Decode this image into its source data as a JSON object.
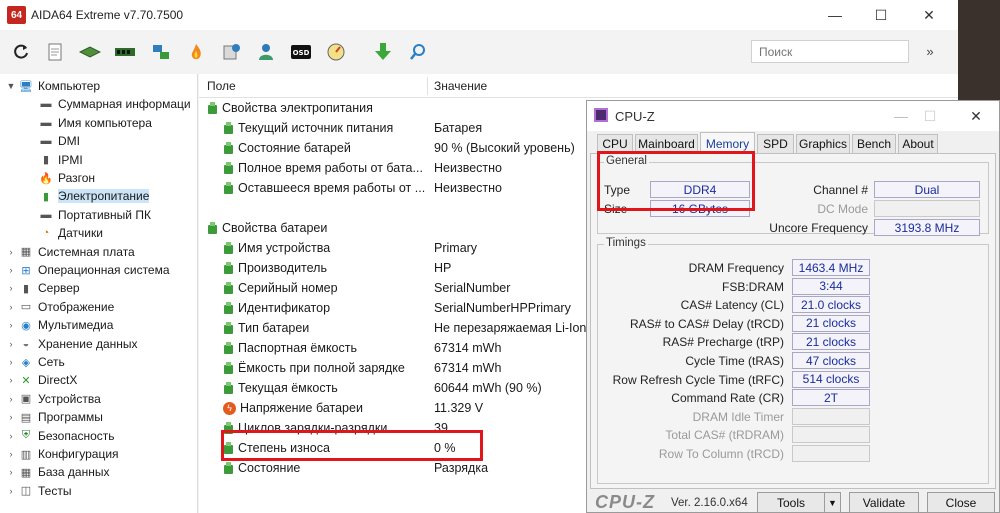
{
  "aida": {
    "title": "AIDA64 Extreme v7.70.7500",
    "logo": "64",
    "search_placeholder": "Поиск",
    "search_more": "»",
    "toolbar_icons": [
      "refresh-icon",
      "report-icon",
      "motherboard-icon",
      "memory-icon",
      "network-icon",
      "flame-icon",
      "benchmark-icon",
      "user-icon",
      "osd-icon",
      "gauge-icon",
      "download-icon",
      "search-icon"
    ],
    "tree": [
      {
        "label": "Компьютер",
        "level": 0,
        "expander": "▼",
        "icon": "computer-icon",
        "glyph": "🖥"
      },
      {
        "label": "Суммарная информаци",
        "level": 1,
        "expander": "",
        "icon": "summary-icon",
        "glyph": "▬"
      },
      {
        "label": "Имя компьютера",
        "level": 1,
        "expander": "",
        "icon": "pc-name-icon",
        "glyph": "▬"
      },
      {
        "label": "DMI",
        "level": 1,
        "expander": "",
        "icon": "dmi-icon",
        "glyph": "▬"
      },
      {
        "label": "IPMI",
        "level": 1,
        "expander": "",
        "icon": "ipmi-icon",
        "glyph": "▮"
      },
      {
        "label": "Разгон",
        "level": 1,
        "expander": "",
        "icon": "overclock-icon",
        "glyph": "🔥"
      },
      {
        "label": "Электропитание",
        "level": 1,
        "expander": "",
        "icon": "power-icon",
        "glyph": "▮",
        "selected": true
      },
      {
        "label": "Портативный ПК",
        "level": 1,
        "expander": "",
        "icon": "laptop-icon",
        "glyph": "▬"
      },
      {
        "label": "Датчики",
        "level": 1,
        "expander": "",
        "icon": "sensor-icon",
        "glyph": "◔"
      },
      {
        "label": "Системная плата",
        "level": 0,
        "expander": "›",
        "icon": "motherboard-icon",
        "glyph": "▦"
      },
      {
        "label": "Операционная система",
        "level": 0,
        "expander": "›",
        "icon": "windows-icon",
        "glyph": "⊞"
      },
      {
        "label": "Сервер",
        "level": 0,
        "expander": "›",
        "icon": "server-icon",
        "glyph": "▮"
      },
      {
        "label": "Отображение",
        "level": 0,
        "expander": "›",
        "icon": "display-icon",
        "glyph": "▭"
      },
      {
        "label": "Мультимедиа",
        "level": 0,
        "expander": "›",
        "icon": "multimedia-icon",
        "glyph": "◉"
      },
      {
        "label": "Хранение данных",
        "level": 0,
        "expander": "›",
        "icon": "storage-icon",
        "glyph": "◒"
      },
      {
        "label": "Сеть",
        "level": 0,
        "expander": "›",
        "icon": "network-icon",
        "glyph": "◈"
      },
      {
        "label": "DirectX",
        "level": 0,
        "expander": "›",
        "icon": "directx-icon",
        "glyph": "✕"
      },
      {
        "label": "Устройства",
        "level": 0,
        "expander": "›",
        "icon": "devices-icon",
        "glyph": "▣"
      },
      {
        "label": "Программы",
        "level": 0,
        "expander": "›",
        "icon": "programs-icon",
        "glyph": "▤"
      },
      {
        "label": "Безопасность",
        "level": 0,
        "expander": "›",
        "icon": "security-icon",
        "glyph": "⛨"
      },
      {
        "label": "Конфигурация",
        "level": 0,
        "expander": "›",
        "icon": "config-icon",
        "glyph": "▥"
      },
      {
        "label": "База данных",
        "level": 0,
        "expander": "›",
        "icon": "database-icon",
        "glyph": "▦"
      },
      {
        "label": "Тесты",
        "level": 0,
        "expander": "›",
        "icon": "tests-icon",
        "glyph": "◫"
      }
    ],
    "columns": {
      "field": "Поле",
      "value": "Значение"
    },
    "rows": [
      {
        "field": "Свойства электропитания",
        "value": "",
        "kind": "group"
      },
      {
        "field": "Текущий источник питания",
        "value": "Батарея",
        "kind": "item"
      },
      {
        "field": "Состояние батарей",
        "value": "90 % (Высокий уровень)",
        "kind": "item"
      },
      {
        "field": "Полное время работы от бата...",
        "value": "Неизвестно",
        "kind": "item"
      },
      {
        "field": "Оставшееся время работы от ...",
        "value": "Неизвестно",
        "kind": "item"
      },
      {
        "field": "",
        "value": "",
        "kind": "blank"
      },
      {
        "field": "Свойства батареи",
        "value": "",
        "kind": "group"
      },
      {
        "field": "Имя устройства",
        "value": "Primary",
        "kind": "item"
      },
      {
        "field": "Производитель",
        "value": "HP",
        "kind": "item"
      },
      {
        "field": "Серийный номер",
        "value": "SerialNumber",
        "kind": "item"
      },
      {
        "field": "Идентификатор",
        "value": "SerialNumberHPPrimary",
        "kind": "item"
      },
      {
        "field": "Тип батареи",
        "value": "Не перезаряжаемая Li-Ion",
        "kind": "item"
      },
      {
        "field": "Паспортная ёмкость",
        "value": "67314 mWh",
        "kind": "item"
      },
      {
        "field": "Ёмкость при полной зарядке",
        "value": "67314 mWh",
        "kind": "item"
      },
      {
        "field": "Текущая ёмкость",
        "value": "60644 mWh  (90 %)",
        "kind": "item"
      },
      {
        "field": "Напряжение батареи",
        "value": "11.329 V",
        "kind": "volt"
      },
      {
        "field": "Циклов зарядки-разрядки",
        "value": "39",
        "kind": "item"
      },
      {
        "field": "Степень износа",
        "value": "0 %",
        "kind": "item"
      },
      {
        "field": "Состояние",
        "value": "Разрядка",
        "kind": "item"
      }
    ]
  },
  "cpuz": {
    "title": "CPU-Z",
    "tabs": [
      "CPU",
      "Mainboard",
      "Memory",
      "SPD",
      "Graphics",
      "Bench",
      "About"
    ],
    "active_tab": "Memory",
    "general": {
      "title": "General",
      "type_label": "Type",
      "type_value": "DDR4",
      "size_label": "Size",
      "size_value": "16 GBytes",
      "channel_label": "Channel #",
      "channel_value": "Dual",
      "dcmode_label": "DC Mode",
      "dcmode_value": "",
      "uncore_label": "Uncore Frequency",
      "uncore_value": "3193.8 MHz"
    },
    "timings": {
      "title": "Timings",
      "rows": [
        {
          "label": "DRAM Frequency",
          "value": "1463.4 MHz",
          "dim": false
        },
        {
          "label": "FSB:DRAM",
          "value": "3:44",
          "dim": false
        },
        {
          "label": "CAS# Latency (CL)",
          "value": "21.0 clocks",
          "dim": false
        },
        {
          "label": "RAS# to CAS# Delay (tRCD)",
          "value": "21 clocks",
          "dim": false
        },
        {
          "label": "RAS# Precharge (tRP)",
          "value": "21 clocks",
          "dim": false
        },
        {
          "label": "Cycle Time (tRAS)",
          "value": "47 clocks",
          "dim": false
        },
        {
          "label": "Row Refresh Cycle Time (tRFC)",
          "value": "514 clocks",
          "dim": false
        },
        {
          "label": "Command Rate (CR)",
          "value": "2T",
          "dim": false
        },
        {
          "label": "DRAM Idle Timer",
          "value": "",
          "dim": true
        },
        {
          "label": "Total CAS# (tRDRAM)",
          "value": "",
          "dim": true
        },
        {
          "label": "Row To Column (tRCD)",
          "value": "",
          "dim": true
        }
      ]
    },
    "footer": {
      "logo": "CPU-Z",
      "version": "Ver. 2.16.0.x64",
      "tools_label": "Tools",
      "tools_arrow": "▼",
      "validate_label": "Validate",
      "close_label": "Close"
    }
  }
}
